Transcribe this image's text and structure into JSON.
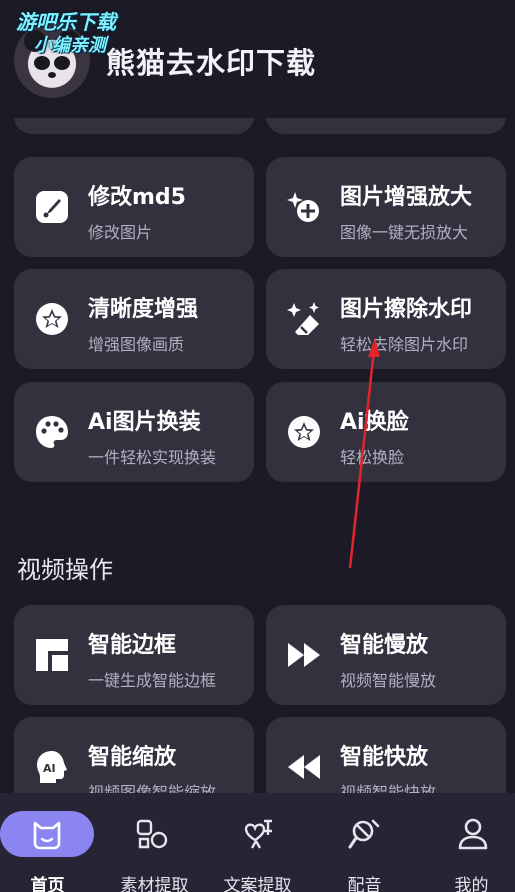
{
  "header": {
    "app_title": "熊猫去水印下载",
    "watermark_line1": "游吧乐下载",
    "watermark_line2": "小编亲测"
  },
  "image_tools": {
    "partial_left_sub": "",
    "partial_right_sub": "",
    "cards": [
      {
        "title": "修改md5",
        "subtitle": "修改图片",
        "icon": "brush-icon"
      },
      {
        "title": "图片增强放大",
        "subtitle": "图像一键无损放大",
        "icon": "sparkle-plus-icon"
      },
      {
        "title": "清晰度增强",
        "subtitle": "增强图像画质",
        "icon": "star-badge-icon"
      },
      {
        "title": "图片擦除水印",
        "subtitle": "轻松去除图片水印",
        "icon": "magic-eraser-icon"
      },
      {
        "title": "Ai图片换装",
        "subtitle": "一件轻松实现换装",
        "icon": "palette-icon"
      },
      {
        "title": "Ai换脸",
        "subtitle": "轻松换脸",
        "icon": "star-badge-icon"
      }
    ]
  },
  "video_section": {
    "title": "视频操作",
    "cards": [
      {
        "title": "智能边框",
        "subtitle": "一键生成智能边框",
        "icon": "border-frame-icon"
      },
      {
        "title": "智能慢放",
        "subtitle": "视频智能慢放",
        "icon": "fast-forward-icon"
      },
      {
        "title": "智能缩放",
        "subtitle": "视频图像智能缩放",
        "icon": "ai-head-icon"
      },
      {
        "title": "智能快放",
        "subtitle": "视频智能快放",
        "icon": "rewind-icon"
      }
    ]
  },
  "bottom_nav": {
    "items": [
      {
        "label": "首页",
        "icon": "home-cat-icon",
        "active": true
      },
      {
        "label": "素材提取",
        "icon": "shapes-icon",
        "active": false
      },
      {
        "label": "文案提取",
        "icon": "text-heart-icon",
        "active": false
      },
      {
        "label": "配音",
        "icon": "mic-slash-icon",
        "active": false
      },
      {
        "label": "我的",
        "icon": "person-icon",
        "active": false
      }
    ]
  },
  "colors": {
    "background": "#1c1a26",
    "card": "#34313f",
    "accent": "#8b85f2",
    "annotation_arrow": "#e0262b"
  }
}
